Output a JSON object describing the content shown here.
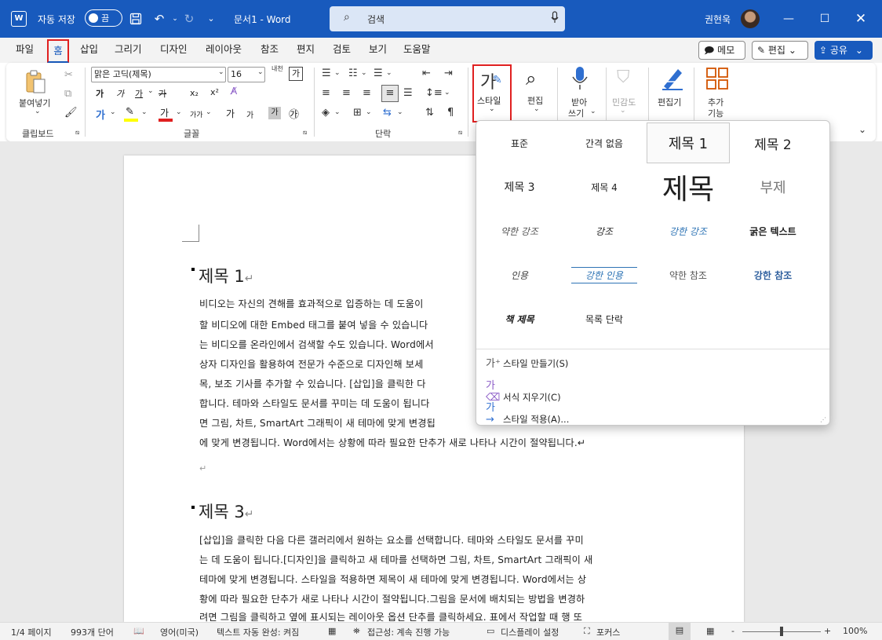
{
  "titlebar": {
    "app_logo": "W",
    "autosave_label": "자동 저장",
    "autosave_state": "끔",
    "doc_title": "문서1 - Word",
    "search_placeholder": "검색",
    "user_name": "권현욱",
    "icons": [
      "save-icon",
      "undo-icon",
      "redo-icon",
      "customize-qat-icon",
      "minimize-icon",
      "restore-icon",
      "close-icon"
    ]
  },
  "tabs": [
    {
      "label": "파일"
    },
    {
      "label": "홈",
      "active": true
    },
    {
      "label": "삽입"
    },
    {
      "label": "그리기"
    },
    {
      "label": "디자인"
    },
    {
      "label": "레이아웃"
    },
    {
      "label": "참조"
    },
    {
      "label": "편지"
    },
    {
      "label": "검토"
    },
    {
      "label": "보기"
    },
    {
      "label": "도움말"
    }
  ],
  "tab_actions": {
    "memo": "메모",
    "edit_mode": "편집",
    "share": "공유"
  },
  "ribbon": {
    "clipboard": {
      "paste": "붙여넣기",
      "group": "클립보드"
    },
    "font": {
      "name": "맑은 고딕(제목)",
      "size": "16",
      "group": "글꼴",
      "hanja": "내천",
      "ga_box": "가",
      "bold": "가",
      "italic": "가",
      "underline": "가",
      "strike": "가",
      "subscript": "x₂",
      "superscript": "x²",
      "font_color": "가",
      "change_case": "가가",
      "grow": "가",
      "shrink": "가",
      "shade": "가",
      "circle": "㉮"
    },
    "paragraph": {
      "group": "단락"
    },
    "styles": {
      "label": "스타일"
    },
    "editing": {
      "label": "편집"
    },
    "dictate": {
      "label1": "받아",
      "label2": "쓰기"
    },
    "sensitivity": {
      "label": "민감도"
    },
    "editor": {
      "label": "편집기"
    },
    "addins": {
      "label1": "추가",
      "label2": "기능"
    }
  },
  "gallery": {
    "styles": [
      {
        "label": "표준"
      },
      {
        "label": "간격 없음"
      },
      {
        "label": "제목 1"
      },
      {
        "label": "제목 2"
      },
      {
        "label": "제목 3"
      },
      {
        "label": "제목 4"
      },
      {
        "label": "제목"
      },
      {
        "label": "부제"
      },
      {
        "label": "약한 강조"
      },
      {
        "label": "강조"
      },
      {
        "label": "강한 강조"
      },
      {
        "label": "굵은 텍스트"
      },
      {
        "label": "인용"
      },
      {
        "label": "강한 인용"
      },
      {
        "label": "약한 참조"
      },
      {
        "label": "강한 참조"
      },
      {
        "label": "책 제목"
      },
      {
        "label": "목록 단락"
      }
    ],
    "actions": [
      {
        "label": "스타일 만들기(S)"
      },
      {
        "label": "서식 지우기(C)"
      },
      {
        "label": "스타일 적용(A)..."
      }
    ]
  },
  "document": {
    "heading1": "제목 1",
    "para1": [
      "비디오는 자신의 견해를 효과적으로 입증하는 데 도움이",
      "할 비디오에 대한 Embed 태그를 붙여 넣을 수 있습니다",
      "는 비디오를 온라인에서 검색할 수도 있습니다. Word에서",
      "상자 디자인을 활용하여 전문가 수준으로 디자인해 보세",
      "목, 보조 기사를 추가할 수 있습니다. [삽입]을 클릭한 다",
      "합니다. 테마와 스타일도 문서를 꾸미는 데 도움이 됩니다",
      "면 그림, 차트, SmartArt 그래픽이 새 테마에 맞게 변경됩",
      "에 맞게 변경됩니다. Word에서는 상황에 따라 필요한 단추가 새로 나타나 시간이 절약됩니다.↵"
    ],
    "empty_para": "↵",
    "heading3": "제목 3",
    "para2": [
      "[삽입]을 클릭한 다음 다른 갤러리에서 원하는 요소를 선택합니다. 테마와 스타일도 문서를 꾸미",
      "는 데 도움이 됩니다.[디자인]을 클릭하고 새 테마를 선택하면 그림, 차트, SmartArt 그래픽이 새",
      "테마에 맞게 변경됩니다. 스타일을 적용하면 제목이 새 테마에 맞게 변경됩니다. Word에서는 상",
      "황에 따라 필요한 단추가 새로 나타나 시간이 절약됩니다.그림을 문서에 배치되는 방법을 변경하",
      "려면 그림을 클릭하고 옆에 표시되는 레이아웃 옵션 단추를 클릭하세요. 표에서 작업할 때 행 또"
    ],
    "para_mark": "↵"
  },
  "statusbar": {
    "page": "1/4 페이지",
    "words": "993개 단어",
    "language": "영어(미국)",
    "autocomplete": "텍스트 자동 완성: 켜짐",
    "accessibility": "접근성: 계속 진행 가능",
    "display": "디스플레이 설정",
    "focus": "포커스",
    "zoom": "100%",
    "zoom_minus": "-",
    "zoom_plus": "+"
  },
  "colors": {
    "brand": "#185abd",
    "highlight_red": "#e02020",
    "accent_blue_text": "#2e74b5"
  }
}
